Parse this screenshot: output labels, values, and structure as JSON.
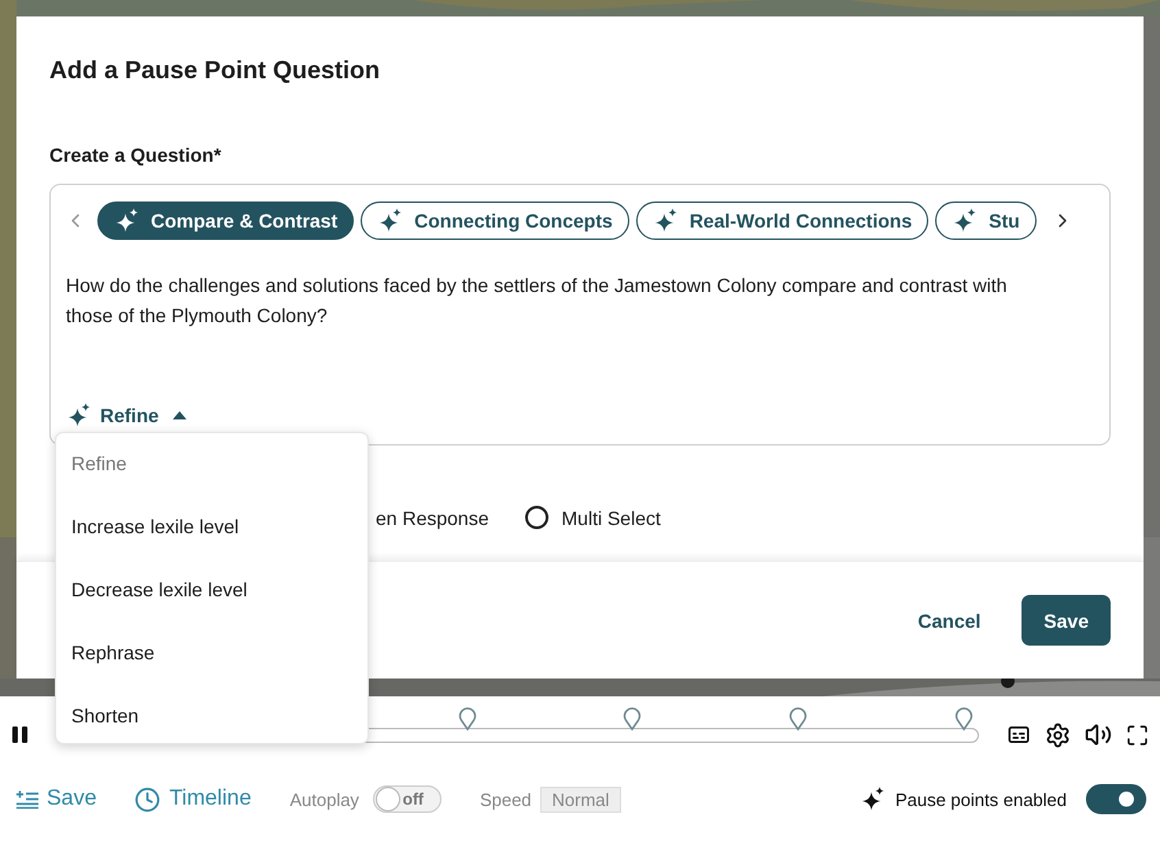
{
  "dialog": {
    "title": "Add a Pause Point Question",
    "question_label": "Create a Question*",
    "prompt_chips": [
      {
        "label": "Compare & Contrast",
        "selected": true
      },
      {
        "label": "Connecting Concepts",
        "selected": false
      },
      {
        "label": "Real-World Connections",
        "selected": false
      },
      {
        "label": "Stu",
        "selected": false
      }
    ],
    "question_text": "How do the challenges and solutions faced by the settlers of the Jamestown Colony compare and contrast with those of the Plymouth Colony?",
    "refine_button": {
      "label": "Refine",
      "expanded": true
    },
    "refine_menu": {
      "header": "Refine",
      "items": [
        "Increase lexile level",
        "Decrease lexile level",
        "Rephrase",
        "Shorten"
      ]
    },
    "answer_type": {
      "options": [
        {
          "label": "en Response"
        },
        {
          "label": "Multi Select",
          "selected": false
        }
      ]
    },
    "buttons": {
      "cancel": "Cancel",
      "save": "Save"
    }
  },
  "player": {
    "playing": true
  },
  "toolbar": {
    "save": "Save",
    "timeline": "Timeline",
    "autoplay": {
      "label": "Autoplay",
      "on": false,
      "state_text": "off"
    },
    "speed": {
      "label": "Speed",
      "value": "Normal"
    },
    "pause_points": {
      "label": "Pause points enabled",
      "on": true
    }
  }
}
